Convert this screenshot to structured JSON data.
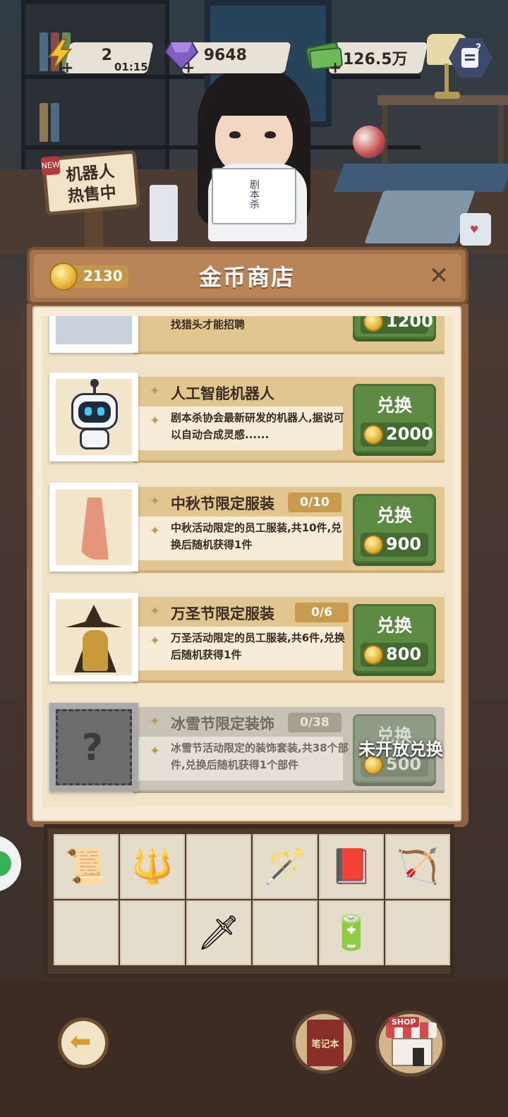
{
  "resources": {
    "energy": {
      "icon": "lightning-icon",
      "value": "2",
      "timer": "01:15"
    },
    "gems": {
      "icon": "gem-icon",
      "value": "9648"
    },
    "cash": {
      "icon": "cash-icon",
      "value": "126.5万"
    },
    "plus": "+"
  },
  "scene": {
    "sign_tag": "NEW",
    "sign_line1": "机器人",
    "sign_line2": "热售中",
    "book_title": "剧本杀"
  },
  "shop": {
    "title": "金币商店",
    "coins": "2130",
    "close": "✕",
    "items": [
      {
        "desc": "找猎头才能招聘",
        "price": "1200"
      },
      {
        "title": "人工智能机器人",
        "desc": "剧本杀协会最新研发的机器人,据说可以自动合成灵感......",
        "button": "兑换",
        "price": "2000"
      },
      {
        "title": "中秋节限定服装",
        "badge": "0/10",
        "desc": "中秋活动限定的员工服装,共10件,兑换后随机获得1件",
        "button": "兑换",
        "price": "900"
      },
      {
        "title": "万圣节限定服装",
        "badge": "0/6",
        "desc": "万圣活动限定的员工服装,共6件,兑换后随机获得1件",
        "button": "兑换",
        "price": "800"
      },
      {
        "title": "冰雪节限定装饰",
        "badge": "0/38",
        "desc": "冰雪节活动限定的装饰套装,共38个部件,兑换后随机获得1个部件",
        "button": "兑换",
        "price": "500",
        "locked_text": "未开放兑换",
        "placeholder": "?"
      }
    ]
  },
  "bottom": {
    "back_icon": "back-arrow-icon",
    "notebook_label": "笔记本",
    "shop_label": "SHOP"
  }
}
